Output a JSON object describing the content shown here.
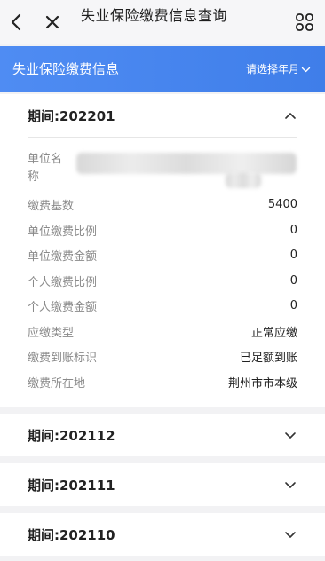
{
  "header": {
    "title": "失业保险缴费信息查询",
    "icons": {
      "back": "back-chevron-icon",
      "close": "close-icon",
      "menu": "grid-menu-icon"
    }
  },
  "banner": {
    "title": "失业保险缴费信息",
    "picker_label": "请选择年月",
    "accent_color": "#4f8cf3"
  },
  "records": [
    {
      "period": "期间:202201",
      "expanded": true,
      "fields": [
        {
          "label": "单位名称",
          "value": ""
        },
        {
          "label": "缴费基数",
          "value": "5400"
        },
        {
          "label": "单位缴费比例",
          "value": "0"
        },
        {
          "label": "单位缴费金额",
          "value": "0"
        },
        {
          "label": "个人缴费比例",
          "value": "0"
        },
        {
          "label": "个人缴费金额",
          "value": "0"
        },
        {
          "label": "应缴类型",
          "value": "正常应缴"
        },
        {
          "label": "缴费到账标识",
          "value": "已足额到账"
        },
        {
          "label": "缴费所在地",
          "value": "荆州市市本级"
        }
      ]
    },
    {
      "period": "期间:202112",
      "expanded": false
    },
    {
      "period": "期间:202111",
      "expanded": false
    },
    {
      "period": "期间:202110",
      "expanded": false
    }
  ]
}
